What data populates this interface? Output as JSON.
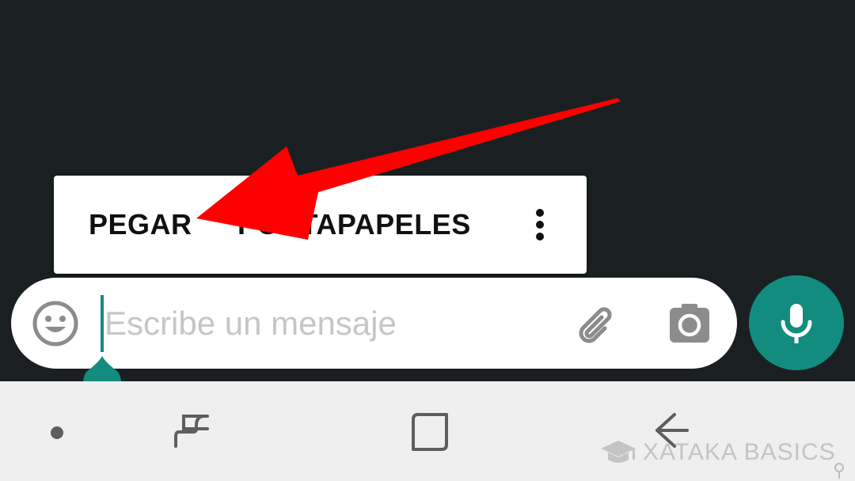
{
  "context_menu": {
    "paste_label": "PEGAR",
    "clipboard_label": "PORTAPAPELES",
    "more_icon": "more-vert-icon"
  },
  "composer": {
    "placeholder": "Escribe un mensaje",
    "emoji_icon": "emoji-icon",
    "attach_icon": "paperclip-icon",
    "camera_icon": "camera-icon",
    "mic_icon": "mic-icon"
  },
  "navigation": {
    "items": [
      "dot-icon",
      "recents-icon",
      "home-icon",
      "back-icon"
    ]
  },
  "watermark": {
    "text": "XATAKA BASICS",
    "icon": "graduation-cap-icon"
  },
  "colors": {
    "accent": "#128c7e",
    "background": "#1a2022",
    "annotation": "#ff0000",
    "nav_bar": "#efefef"
  }
}
